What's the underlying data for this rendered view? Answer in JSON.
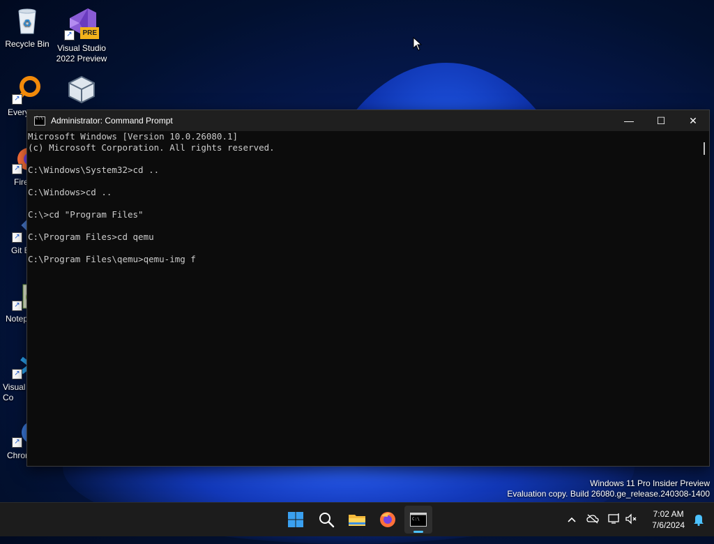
{
  "desktop": {
    "icons": [
      {
        "label": "Recycle Bin",
        "icon": "recycle-bin-icon"
      },
      {
        "label": "Visual Studio 2022 Preview",
        "icon": "visual-studio-preview-icon",
        "badge": "PRE"
      },
      {
        "label": "Every",
        "icon": "everything-search-icon"
      },
      {
        "label": "",
        "icon": "virtualbox-icon"
      },
      {
        "label": "Fire",
        "icon": "firefox-icon"
      },
      {
        "label": "Git B",
        "icon": "git-bash-icon"
      },
      {
        "label": "Notep",
        "icon": "notepad-plus-plus-icon"
      },
      {
        "label": "Visual Co",
        "icon": "vscode-icon"
      },
      {
        "label": "Chron",
        "icon": "chrome-icon"
      }
    ]
  },
  "window": {
    "title": "Administrator: Command Prompt",
    "minimize": "—",
    "maximize": "☐",
    "close": "✕",
    "console_text": "Microsoft Windows [Version 10.0.26080.1]\n(c) Microsoft Corporation. All rights reserved.\n\nC:\\Windows\\System32>cd ..\n\nC:\\Windows>cd ..\n\nC:\\>cd \"Program Files\"\n\nC:\\Program Files>cd qemu\n\nC:\\Program Files\\qemu>qemu-img f"
  },
  "watermark": {
    "line1": "Windows 11 Pro Insider Preview",
    "line2": "Evaluation copy. Build 26080.ge_release.240308-1400"
  },
  "taskbar": {
    "apps": [
      {
        "name": "start",
        "icon": "windows-start-icon"
      },
      {
        "name": "search",
        "icon": "search-icon"
      },
      {
        "name": "file-explorer",
        "icon": "folder-icon"
      },
      {
        "name": "firefox",
        "icon": "firefox-icon"
      },
      {
        "name": "command-prompt",
        "icon": "terminal-icon",
        "active": true
      }
    ],
    "tray": {
      "chevron": "^",
      "time": "7:02 AM",
      "date": "7/6/2024"
    }
  },
  "colors": {
    "console_bg": "#0c0c0c",
    "console_text": "#cccccc",
    "titlebar_bg": "#1f1f1f",
    "taskbar_bg": "#1c1c1c",
    "accent": "#4cc2ff"
  }
}
